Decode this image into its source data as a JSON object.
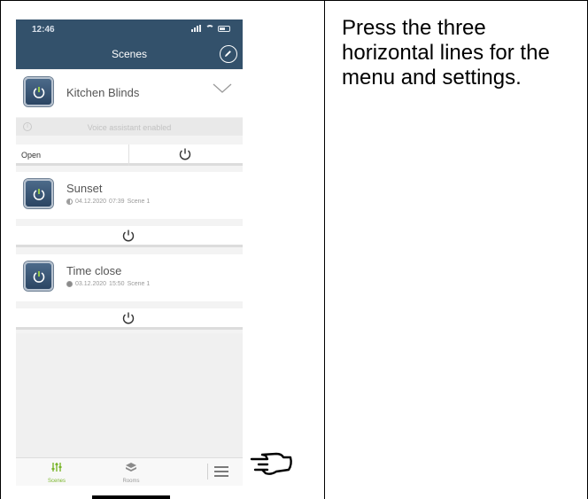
{
  "status_bar": {
    "time": "12:46"
  },
  "nav": {
    "title": "Scenes",
    "edit_icon": "pencil-icon"
  },
  "scenes": [
    {
      "name": "Kitchen Blinds",
      "icon": "power-icon",
      "expanded": true,
      "voice_text": "Voice assistant enabled",
      "open_label": "Open"
    },
    {
      "name": "Sunset",
      "icon": "power-icon",
      "meta_icon": "half-circle-icon",
      "date": "04.12.2020",
      "time": "07:39",
      "tag": "Scene 1"
    },
    {
      "name": "Time close",
      "icon": "power-icon",
      "meta_icon": "clock-icon",
      "date": "03.12.2020",
      "time": "15:50",
      "tag": "Scene 1"
    }
  ],
  "tab_bar": {
    "tabs": [
      {
        "label": "Scenes",
        "icon": "sliders-icon",
        "active": true
      },
      {
        "label": "Rooms",
        "icon": "rooms-icon",
        "active": false
      }
    ],
    "menu_icon": "hamburger-menu-icon"
  },
  "instruction": {
    "text": "Press the three horizontal lines for the menu and settings."
  },
  "colors": {
    "nav_bg": "#33516b",
    "active_tab": "#79b52a",
    "background": "#f3f3f3"
  }
}
